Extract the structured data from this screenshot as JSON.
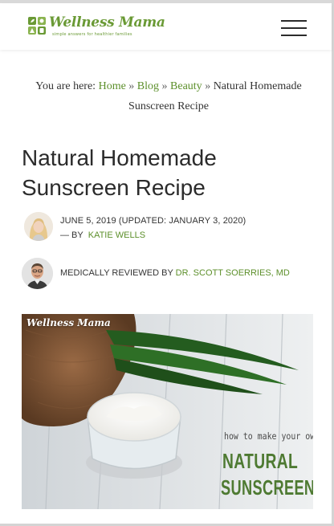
{
  "header": {
    "logo_name": "Wellness Mama",
    "logo_tagline": "simple answers for healthier families",
    "menu_icon": "hamburger-menu-icon"
  },
  "breadcrumb": {
    "prefix": "You are here:",
    "items": [
      {
        "label": "Home",
        "link": true
      },
      {
        "label": "Blog",
        "link": true
      },
      {
        "label": "Beauty",
        "link": true
      },
      {
        "label": "Natural Homemade Sunscreen Recipe",
        "link": false
      }
    ],
    "separator": "»"
  },
  "article": {
    "title": "Natural Homemade Sunscreen Recipe",
    "date_line": "JUNE 5, 2019 (UPDATED: JANUARY 3, 2020)",
    "by_prefix": "— BY",
    "author": "KATIE WELLS",
    "reviewed_prefix": "MEDICALLY REVIEWED BY",
    "reviewer": "DR. SCOTT SOERRIES, MD"
  },
  "hero_image": {
    "watermark": "Wellness Mama",
    "text_line1": "how to make your own",
    "text_line2": "NATURAL",
    "text_line3": "SUNSCREEN"
  },
  "colors": {
    "brand_green": "#5c8f2a",
    "text": "#2b2b2b"
  }
}
